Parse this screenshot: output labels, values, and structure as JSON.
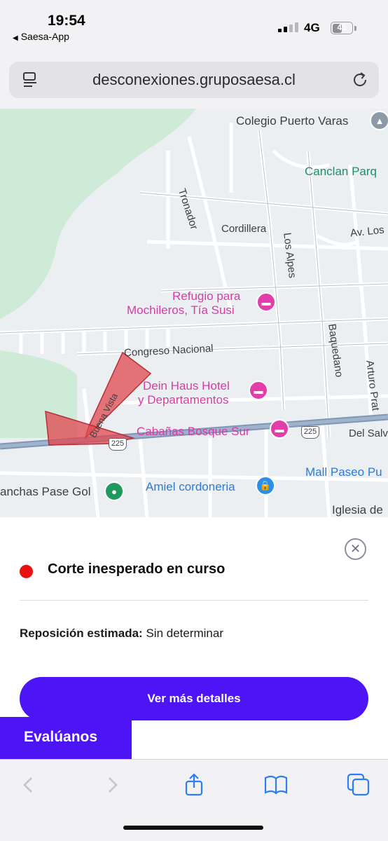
{
  "status_bar": {
    "time": "19:54",
    "back_app": "Saesa-App",
    "network": "4G",
    "battery": "45"
  },
  "browser": {
    "url": "desconexiones.gruposaesa.cl"
  },
  "map": {
    "labels": {
      "colegio": "Colegio Puerto Varas",
      "tronador": "Tronador",
      "canclan": "Canclan Parq",
      "cordillera": "Cordillera",
      "av_los": "Av. Los",
      "los_alpes": "Los Alpes",
      "refugio_1": "Refugio para",
      "refugio_2": "Mochileros, Tía Susi",
      "baquedano": "Baquedano",
      "congreso": "Congreso Nacional",
      "arturo_prat": "Arturo Prat",
      "dein_1": "Dein Haus Hotel",
      "dein_2": "y Departamentos",
      "buena_vista": "Buena Vista",
      "cabanas": "Cabañas Bosque Sur",
      "del_salv": "Del Salv",
      "mall": "Mall Paseo Pu",
      "canchas": "anchas Pase Gol",
      "amiel": "Amiel cordoneria",
      "iglesia": "Iglesia de"
    },
    "route_shields": [
      "225",
      "225"
    ],
    "outage_color": "#e0474f"
  },
  "sheet": {
    "status_title": "Corte inesperado en curso",
    "status_color": "#ea1010",
    "reposicion_label": "Reposición estimada:",
    "reposicion_value": "Sin determinar",
    "more_button": "Ver más detalles",
    "evaluanos": "Evalúanos",
    "accent": "#4d14f5"
  },
  "toolbar": {
    "icons": [
      "back-icon",
      "forward-icon",
      "share-icon",
      "bookmarks-icon",
      "tabs-icon"
    ]
  }
}
